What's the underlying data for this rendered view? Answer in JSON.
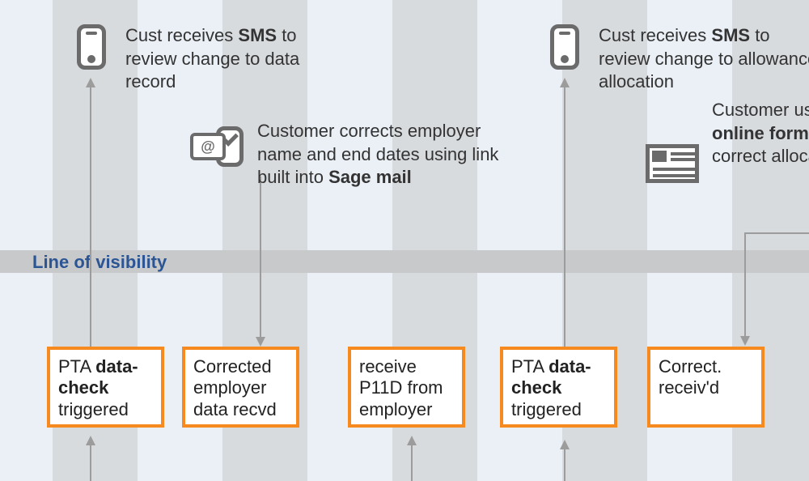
{
  "lov_label": "Line of visibility",
  "top_texts": {
    "sms_review": {
      "pre": "Cust receives ",
      "bold": "SMS",
      "post": " to review change to data record"
    },
    "cust_corrects": {
      "pre": "Customer corrects employer name and end dates using link built into ",
      "bold": "Sage mail",
      "post": ""
    },
    "sms_allowance": {
      "pre": "Cust receives ",
      "bold": "SMS",
      "post": " to review change to allowance allocation"
    },
    "pta_online": {
      "pre": "Customer uses ",
      "bold": "PTA online form",
      "post": " to correct allocation"
    }
  },
  "process_boxes": [
    {
      "pre": "PTA ",
      "bold": "data-check",
      "post": " triggered"
    },
    {
      "pre": "Corrected employer data recvd",
      "bold": "",
      "post": ""
    },
    {
      "pre": "receive P11D from employer",
      "bold": "",
      "post": ""
    },
    {
      "pre": "PTA ",
      "bold": "data-check",
      "post": " triggered"
    },
    {
      "pre": "Correct. receiv'd",
      "bold": "",
      "post": ""
    }
  ],
  "colors": {
    "accent": "#f68a1e",
    "lov": "#c8c9ca",
    "lov_text": "#2b5594",
    "line": "#9c9c9c",
    "band": "#d8dbde",
    "bg": "#eaf0f6"
  }
}
